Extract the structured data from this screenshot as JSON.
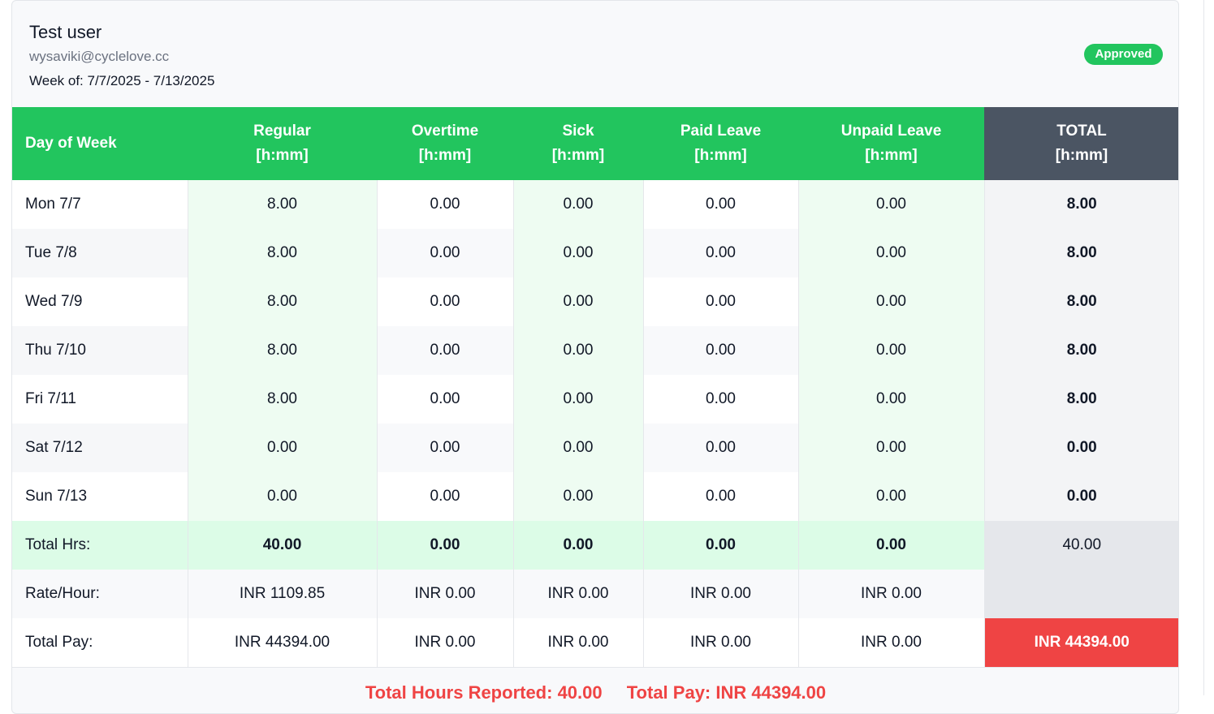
{
  "employee": {
    "name": "Test user",
    "email": "wysaviki@cyclelove.cc",
    "week": "Week of: 7/7/2025 - 7/13/2025"
  },
  "status": "Approved",
  "table": {
    "headers": [
      {
        "line1": "Day of Week",
        "line2": ""
      },
      {
        "line1": "Regular",
        "line2": "[h:mm]"
      },
      {
        "line1": "Overtime",
        "line2": "[h:mm]"
      },
      {
        "line1": "Sick",
        "line2": "[h:mm]"
      },
      {
        "line1": "Paid Leave",
        "line2": "[h:mm]"
      },
      {
        "line1": "Unpaid Leave",
        "line2": "[h:mm]"
      },
      {
        "line1": "TOTAL",
        "line2": "[h:mm]"
      }
    ],
    "rows": [
      {
        "day": "Mon 7/7",
        "regular": "8.00",
        "overtime": "0.00",
        "sick": "0.00",
        "paid_leave": "0.00",
        "unpaid_leave": "0.00",
        "total": "8.00"
      },
      {
        "day": "Tue 7/8",
        "regular": "8.00",
        "overtime": "0.00",
        "sick": "0.00",
        "paid_leave": "0.00",
        "unpaid_leave": "0.00",
        "total": "8.00"
      },
      {
        "day": "Wed 7/9",
        "regular": "8.00",
        "overtime": "0.00",
        "sick": "0.00",
        "paid_leave": "0.00",
        "unpaid_leave": "0.00",
        "total": "8.00"
      },
      {
        "day": "Thu 7/10",
        "regular": "8.00",
        "overtime": "0.00",
        "sick": "0.00",
        "paid_leave": "0.00",
        "unpaid_leave": "0.00",
        "total": "8.00"
      },
      {
        "day": "Fri 7/11",
        "regular": "8.00",
        "overtime": "0.00",
        "sick": "0.00",
        "paid_leave": "0.00",
        "unpaid_leave": "0.00",
        "total": "8.00"
      },
      {
        "day": "Sat 7/12",
        "regular": "0.00",
        "overtime": "0.00",
        "sick": "0.00",
        "paid_leave": "0.00",
        "unpaid_leave": "0.00",
        "total": "0.00"
      },
      {
        "day": "Sun 7/13",
        "regular": "0.00",
        "overtime": "0.00",
        "sick": "0.00",
        "paid_leave": "0.00",
        "unpaid_leave": "0.00",
        "total": "0.00"
      }
    ],
    "totals": {
      "label": "Total Hrs:",
      "regular": "40.00",
      "overtime": "0.00",
      "sick": "0.00",
      "paid_leave": "0.00",
      "unpaid_leave": "0.00",
      "total": "40.00"
    },
    "rates": {
      "label": "Rate/Hour:",
      "regular": "INR 1109.85",
      "overtime": "INR 0.00",
      "sick": "INR 0.00",
      "paid_leave": "INR 0.00",
      "unpaid_leave": "INR 0.00"
    },
    "pay": {
      "label": "Total Pay:",
      "regular": "INR 44394.00",
      "overtime": "INR 0.00",
      "sick": "INR 0.00",
      "paid_leave": "INR 0.00",
      "unpaid_leave": "INR 0.00",
      "total": "INR 44394.00"
    }
  },
  "footer": {
    "hours": "Total Hours Reported: 40.00",
    "pay": "Total Pay: INR 44394.00"
  },
  "colors": {
    "accent": "#22c55e",
    "total_header": "#4b5563",
    "pay_highlight": "#ef4444"
  }
}
